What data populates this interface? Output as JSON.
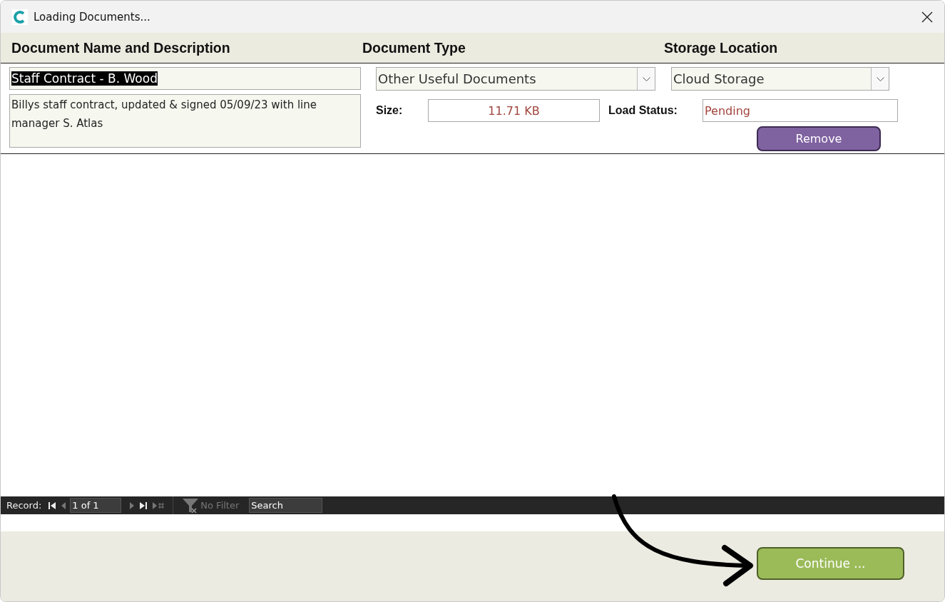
{
  "window": {
    "title": "Loading Documents..."
  },
  "columns": [
    "Document Name and Description",
    "Document Type",
    "Storage Location"
  ],
  "record": {
    "name": {
      "value": "Staff Contract - B. Wood",
      "text_selected": true
    },
    "description": "Billys staff contract, updated & signed 05/09/23 with line manager S. Atlas",
    "document_type": "Other Useful Documents",
    "storage_location": "Cloud Storage",
    "size_label": "Size:",
    "size": "11.71 KB",
    "status_label": "Load Status:",
    "status": "Pending",
    "remove_button": "Remove"
  },
  "navigation": {
    "label": "Record:",
    "position": "1 of 1",
    "buttons": [
      {
        "kind": "first",
        "disabled": false
      },
      {
        "kind": "prev",
        "disabled": true
      },
      {
        "kind": "next",
        "disabled": true
      },
      {
        "kind": "last",
        "disabled": false
      },
      {
        "kind": "new",
        "disabled": true
      }
    ],
    "filter": {
      "label": "No Filter",
      "disabled": true
    },
    "search": {
      "placeholder": "Search"
    }
  },
  "continue_button": "Continue ..."
}
